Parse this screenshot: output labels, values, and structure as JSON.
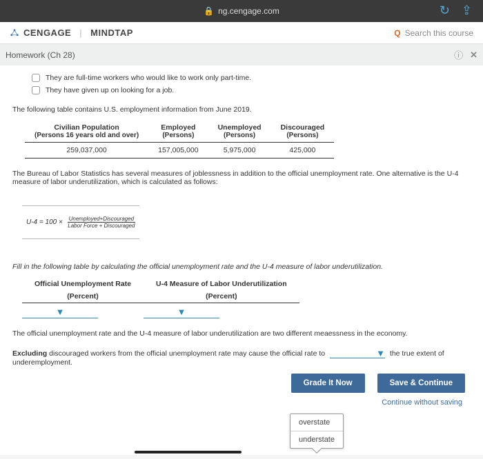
{
  "browser": {
    "url": "ng.cengage.com"
  },
  "header": {
    "brand1": "CENGAGE",
    "brand2": "MINDTAP",
    "search_placeholder": "Search this course"
  },
  "subheader": {
    "title": "Homework (Ch 28)"
  },
  "checks": {
    "c1": "They are full-time workers who would like to work only part-time.",
    "c2": "They have given up on looking for a job."
  },
  "intro": "The following table contains U.S. employment information from June 2019.",
  "table": {
    "h1a": "Civilian Population",
    "h1b": "(Persons 16 years old and over)",
    "h2a": "Employed",
    "h2b": "(Persons)",
    "h3a": "Unemployed",
    "h3b": "(Persons)",
    "h4a": "Discouraged",
    "h4b": "(Persons)",
    "r1c1": "259,037,000",
    "r1c2": "157,005,000",
    "r1c3": "5,975,000",
    "r1c4": "425,000"
  },
  "bls": "The Bureau of Labor Statistics has several measures of joblessness in addition to the official unemployment rate. One alternative is the U-4 measure of labor underutilization, which is calculated as follows:",
  "formula": {
    "lhs": "U-4",
    "eq": " = 100 × ",
    "num": "Unemployed+Discouraged",
    "den": "Labor Force + Discouraged"
  },
  "fill_prompt": "Fill in the following table by calculating the official unemployment rate and the U-4 measure of labor underutilization.",
  "fill": {
    "h1a": "Official Unemployment Rate",
    "h1b": "(Percent)",
    "h2a": "U-4 Measure of Labor Underutilization",
    "h2b": "(Percent)"
  },
  "sentence1a": "The official unemployment rate and the U-4 measure of labor underutilization are two different mea",
  "sentence1b": "essness in the economy.",
  "sentence2a": "Excluding",
  "sentence2b": " discouraged workers from the official unemployment rate may cause the official rate to ",
  "sentence2c": " the true extent of underemployment.",
  "menu": {
    "opt1": "overstate",
    "opt2": "understate"
  },
  "buttons": {
    "grade": "Grade It Now",
    "save": "Save & Continue",
    "link": "Continue without saving"
  }
}
